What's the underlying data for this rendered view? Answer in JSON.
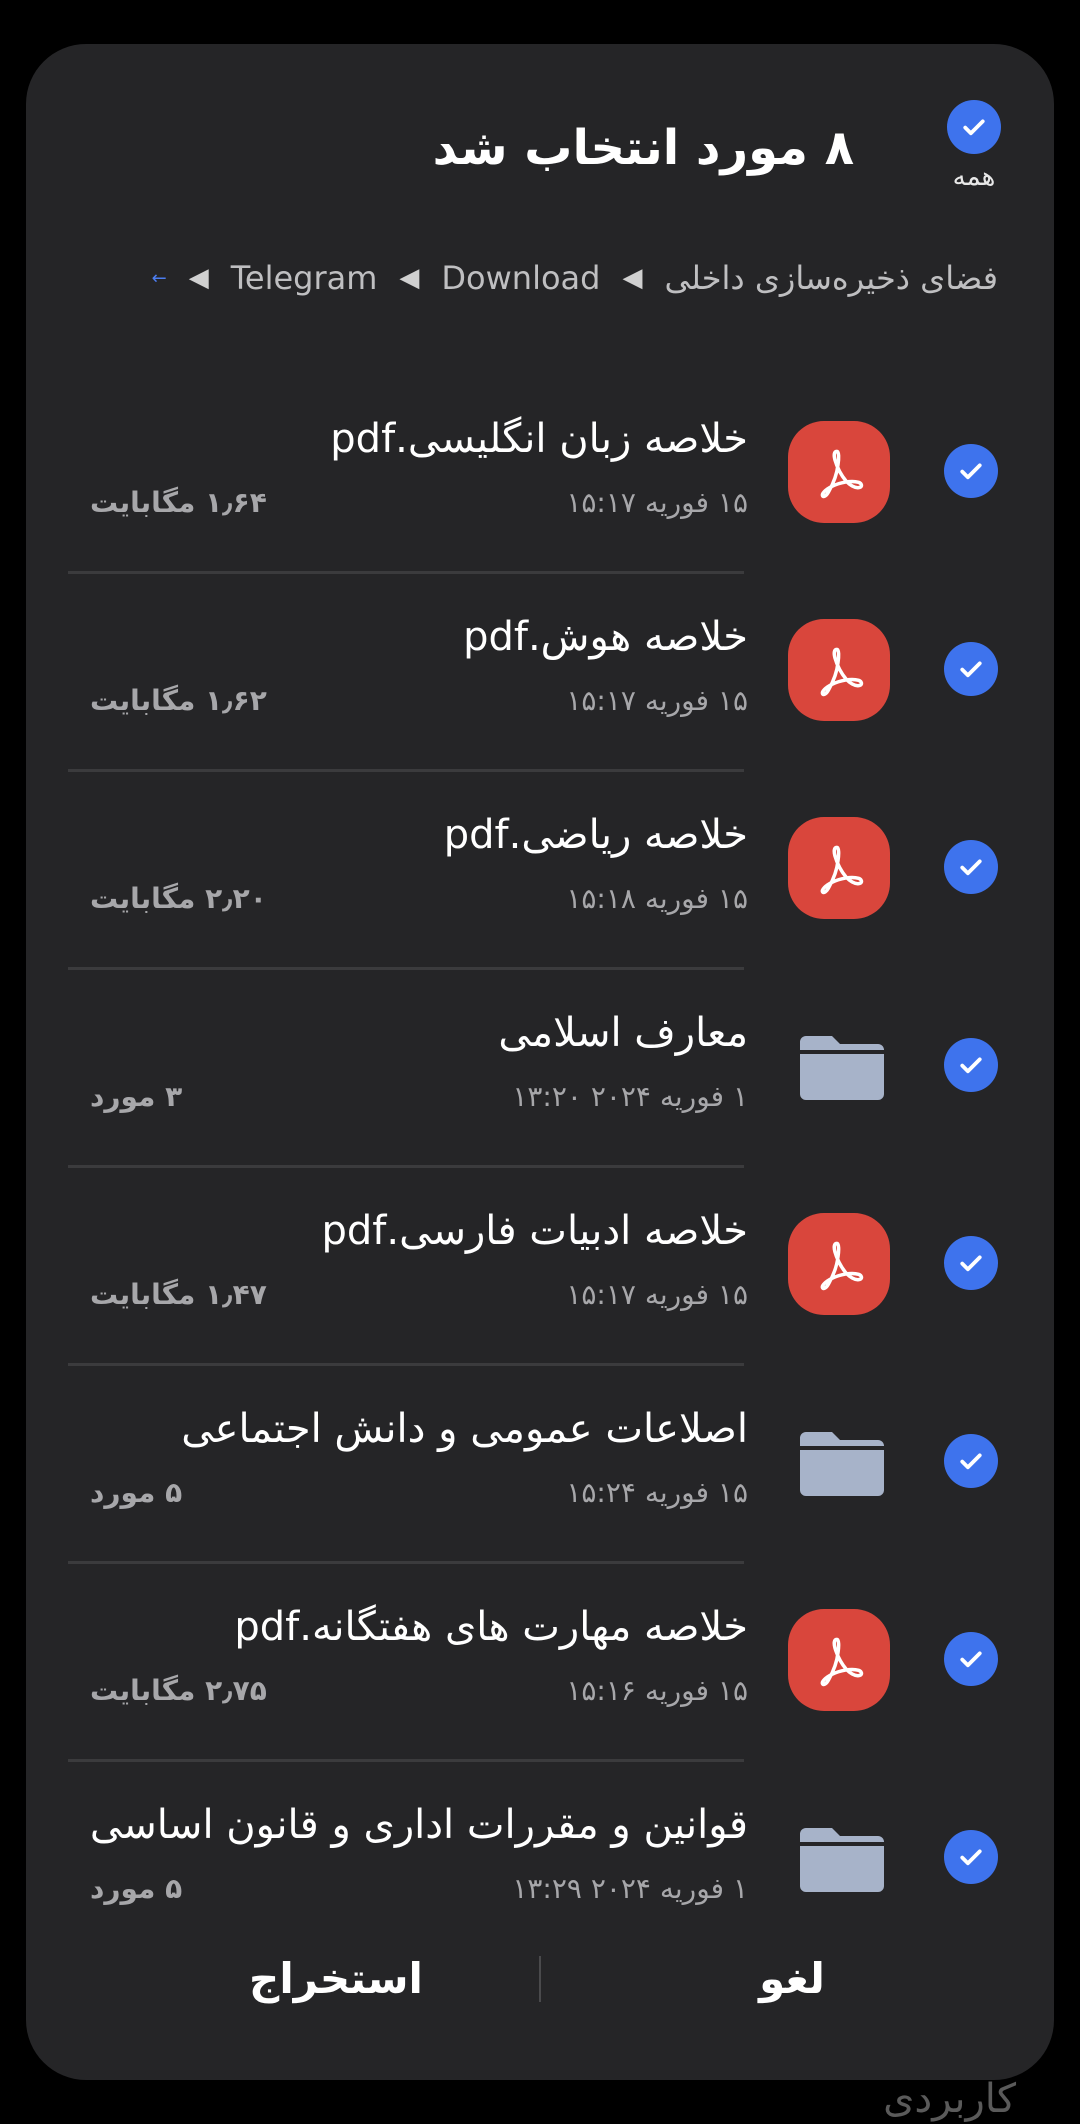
{
  "header": {
    "title": "۸ مورد انتخاب شد",
    "select_all_label": "همه"
  },
  "breadcrumb": {
    "items": [
      "فضای ذخیره‌سازی داخلی",
      "Download",
      "Telegram"
    ],
    "separator": "◀",
    "more": "←"
  },
  "rows": [
    {
      "type": "pdf",
      "icon": "pdf-icon",
      "name": "خلاصه زبان انگلیسی.pdf",
      "date": "۱۵ فوریه ۱۵:۱۷",
      "size": "۱٫۶۴ مگابایت",
      "selected": true
    },
    {
      "type": "pdf",
      "icon": "pdf-icon",
      "name": "خلاصه هوش.pdf",
      "date": "۱۵ فوریه ۱۵:۱۷",
      "size": "۱٫۶۲ مگابایت",
      "selected": true
    },
    {
      "type": "pdf",
      "icon": "pdf-icon",
      "name": "خلاصه ریاضی.pdf",
      "date": "۱۵ فوریه ۱۵:۱۸",
      "size": "۲٫۲۰ مگابایت",
      "selected": true
    },
    {
      "type": "folder",
      "icon": "folder-icon",
      "name": "معارف اسلامی",
      "date": "۱ فوریه ۲۰۲۴ ۱۳:۲۰",
      "size": "۳ مورد",
      "selected": true
    },
    {
      "type": "pdf",
      "icon": "pdf-icon",
      "name": "خلاصه ادبیات فارسی.pdf",
      "date": "۱۵ فوریه ۱۵:۱۷",
      "size": "۱٫۴۷ مگابایت",
      "selected": true
    },
    {
      "type": "folder",
      "icon": "folder-icon",
      "name": "اصلاعات عمومی و دانش اجتماعی",
      "date": "۱۵ فوریه ۱۵:۲۴",
      "size": "۵ مورد",
      "selected": true
    },
    {
      "type": "pdf",
      "icon": "pdf-icon",
      "name": "خلاصه مهارت های هفتگانه.pdf",
      "date": "۱۵ فوریه ۱۵:۱۶",
      "size": "۲٫۷۵ مگابایت",
      "selected": true
    },
    {
      "type": "folder",
      "icon": "folder-icon",
      "name": "قوانین و مقررات اداری و قانون اساسی",
      "date": "۱ فوریه ۲۰۲۴ ۱۳:۲۹",
      "size": "۵ مورد",
      "selected": true
    }
  ],
  "footer": {
    "cancel_label": "لغو",
    "extract_label": "استخراج"
  },
  "background_text": "کاربردی",
  "colors": {
    "accent": "#3e73ed",
    "pdf": "#d9463c",
    "folder": "#a7b3c9",
    "dialog_bg": "#252527"
  }
}
